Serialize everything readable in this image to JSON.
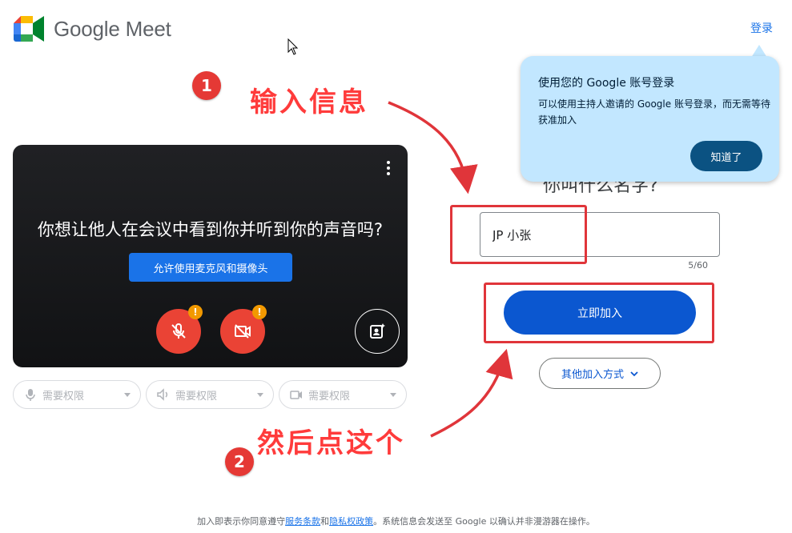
{
  "header": {
    "app_name": "Google Meet",
    "signin_label": "登录"
  },
  "preview": {
    "question": "你想让他人在会议中看到你并听到你的声音吗?",
    "allow_button": "允许使用麦克风和摄像头",
    "warning_badge": "!"
  },
  "devices": [
    {
      "icon": "microphone-icon",
      "label": "需要权限"
    },
    {
      "icon": "speaker-icon",
      "label": "需要权限"
    },
    {
      "icon": "camera-icon",
      "label": "需要权限"
    }
  ],
  "join": {
    "name_prompt": "你叫什么名字?",
    "name_value": "JP 小张",
    "char_count": "5/60",
    "join_button": "立即加入",
    "other_ways_button": "其他加入方式"
  },
  "tooltip": {
    "title": "使用您的 Google 账号登录",
    "body": "可以使用主持人邀请的 Google 账号登录，而无需等待获准加入",
    "button": "知道了"
  },
  "footer": {
    "prefix": "加入即表示你同意遵守",
    "terms_link": "服务条款",
    "and": "和",
    "privacy_link": "隐私权政策",
    "suffix": "。系统信息会发送至 Google 以确认并非漫游器在操作。"
  },
  "annotations": {
    "step1_number": "1",
    "step1_text": "输入信息",
    "step2_number": "2",
    "step2_text": "然后点这个"
  },
  "colors": {
    "primary_blue": "#0b57d0",
    "link_blue": "#1a73e8",
    "error_red": "#ea4335",
    "tooltip_bg": "#c2e7ff",
    "annotation_red": "#e0353a"
  }
}
